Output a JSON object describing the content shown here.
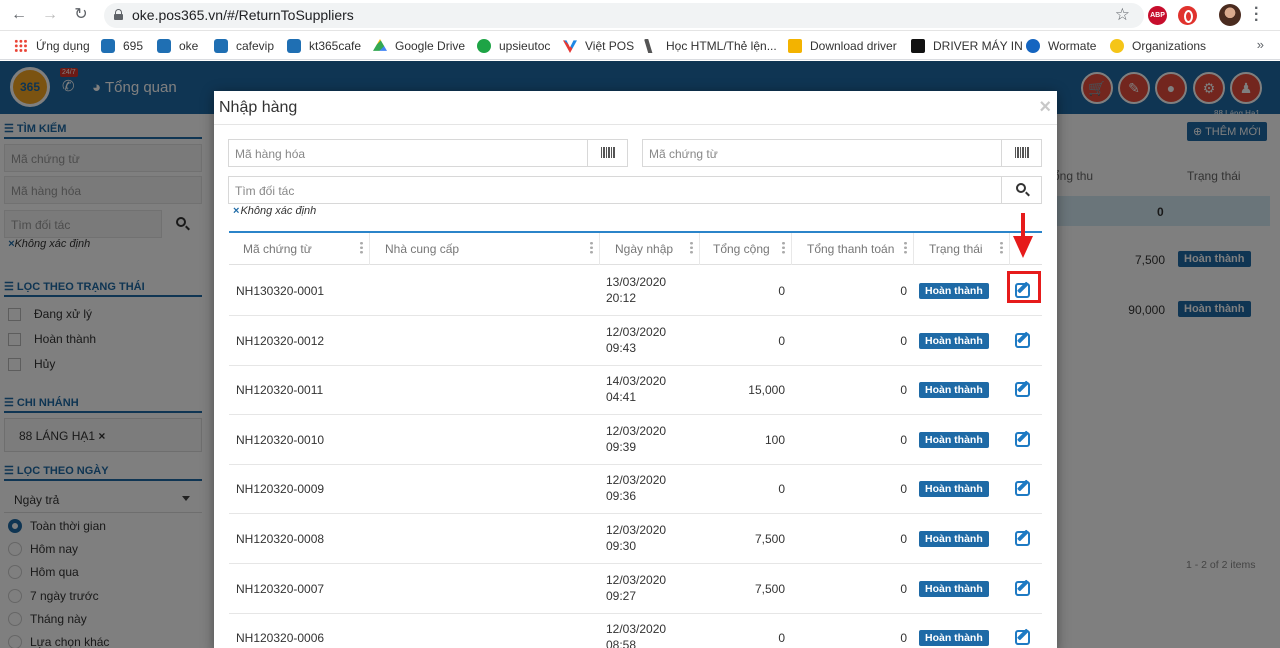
{
  "browser": {
    "url": "oke.pos365.vn/#/ReturnToSuppliers",
    "bookmarks": [
      "Ứng dụng",
      "695",
      "oke",
      "cafevip",
      "kt365cafe",
      "Google Drive",
      "upsieutoc",
      "Việt POS",
      "Học HTML/Thẻ lện...",
      "Download driver",
      "DRIVER MÁY IN",
      "Wormate",
      "Organizations"
    ],
    "abp_label": "ABP"
  },
  "app": {
    "logo_text": "365",
    "badge": "24/7",
    "nav_overview": "Tổng quan",
    "location": "88 Láng Hạ1",
    "add_new": "THÊM MỚI",
    "bg_headers": [
      "ổng thu",
      "Trạng thái"
    ],
    "bg_rows": [
      {
        "total": "0",
        "status": ""
      },
      {
        "total": "7,500",
        "status": "Hoàn thành"
      },
      {
        "total": "90,000",
        "status": "Hoàn thành"
      }
    ],
    "pagination": "1 - 2 of 2 items"
  },
  "sidebar": {
    "search_title": "TÌM KIẾM",
    "inputs": [
      "Mã chứng từ",
      "Mã hàng hóa",
      "Tìm đối tác"
    ],
    "tag": "Không xác định",
    "status_title": "LỌC THEO TRẠNG THÁI",
    "statuses": [
      "Đang xử lý",
      "Hoàn thành",
      "Hủy"
    ],
    "branch_title": "CHI NHÁNH",
    "branch": "88 LÁNG HẠ1",
    "date_title": "LỌC THEO NGÀY",
    "date_select": "Ngày trả",
    "date_options": [
      "Toàn thời gian",
      "Hôm nay",
      "Hôm qua",
      "7 ngày trước",
      "Tháng này",
      "Lựa chọn khác"
    ]
  },
  "modal": {
    "title": "Nhập hàng",
    "close": "×",
    "product_code_placeholder": "Mã hàng hóa",
    "doc_code_placeholder": "Mã chứng từ",
    "partner_placeholder": "Tìm đối tác",
    "tag": "Không xác định",
    "columns": [
      "Mã chứng từ",
      "Nhà cung cấp",
      "Ngày nhập",
      "Tổng cộng",
      "Tổng thanh toán",
      "Trạng thái"
    ],
    "rows": [
      {
        "code": "NH130320-0001",
        "supplier": "",
        "date": "13/03/2020",
        "time": "20:12",
        "total": "0",
        "paid": "0",
        "status": "Hoàn thành"
      },
      {
        "code": "NH120320-0012",
        "supplier": "",
        "date": "12/03/2020",
        "time": "09:43",
        "total": "0",
        "paid": "0",
        "status": "Hoàn thành"
      },
      {
        "code": "NH120320-0011",
        "supplier": "",
        "date": "14/03/2020",
        "time": "04:41",
        "total": "15,000",
        "paid": "0",
        "status": "Hoàn thành"
      },
      {
        "code": "NH120320-0010",
        "supplier": "",
        "date": "12/03/2020",
        "time": "09:39",
        "total": "100",
        "paid": "0",
        "status": "Hoàn thành"
      },
      {
        "code": "NH120320-0009",
        "supplier": "",
        "date": "12/03/2020",
        "time": "09:36",
        "total": "0",
        "paid": "0",
        "status": "Hoàn thành"
      },
      {
        "code": "NH120320-0008",
        "supplier": "",
        "date": "12/03/2020",
        "time": "09:30",
        "total": "7,500",
        "paid": "0",
        "status": "Hoàn thành"
      },
      {
        "code": "NH120320-0007",
        "supplier": "",
        "date": "12/03/2020",
        "time": "09:27",
        "total": "7,500",
        "paid": "0",
        "status": "Hoàn thành"
      },
      {
        "code": "NH120320-0006",
        "supplier": "",
        "date": "12/03/2020",
        "time": "08:58",
        "total": "0",
        "paid": "0",
        "status": "Hoàn thành"
      }
    ]
  },
  "colors": {
    "primary": "#1e6aa6",
    "annotation": "#e61b1b"
  }
}
